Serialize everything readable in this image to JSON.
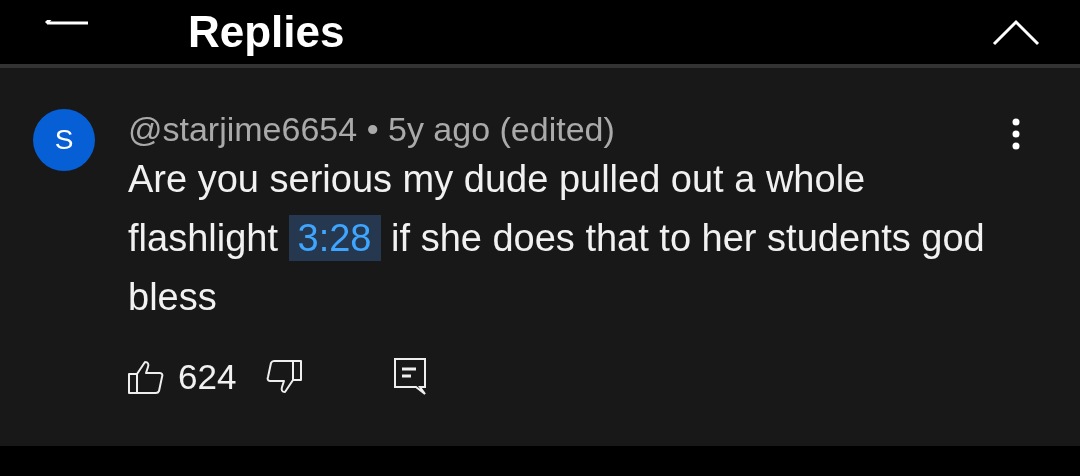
{
  "header": {
    "title": "Replies"
  },
  "comment": {
    "avatar_letter": "S",
    "author": "@starjime6654",
    "separator": "•",
    "meta": "5y ago (edited)",
    "body": [
      {
        "kind": "text",
        "text": "Are you serious my dude pulled out a whole flashlight "
      },
      {
        "kind": "timestamp",
        "text": "3:28"
      },
      {
        "kind": "text",
        "text": " if she does that to her students god bless"
      }
    ],
    "likes": "624"
  }
}
